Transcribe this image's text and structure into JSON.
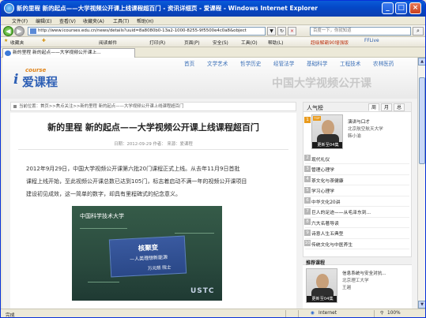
{
  "window": {
    "title": "新的里程 新的起点——大学视频公开课上线课程超百门 - 资讯详细页 - 爱课程 - Windows Internet Explorer",
    "minimize": "_",
    "maximize": "□",
    "close": "×"
  },
  "menubar": {
    "items": [
      "文件(F)",
      "编辑(E)",
      "查看(V)",
      "收藏夹(A)",
      "工具(T)",
      "帮助(H)"
    ]
  },
  "addressbar": {
    "url": "http://www.icourses.edu.cn/news/details?uuid=8a8080b0-13a2-1000-8255-9f5500e4c0a8&object",
    "search_placeholder": "百度一下，你就知道",
    "refresh": "↻",
    "stop": "×",
    "go": "▼",
    "search_btn": "⌕",
    "back": "◀",
    "forward": "▶"
  },
  "toolbar": {
    "favorites": "收藏夹",
    "read_mode": "阅读邮件",
    "print": "打印(R)",
    "page": "页面(P)",
    "safety": "安全(S)",
    "tools": "工具(O)",
    "help": "帮助(L)",
    "ext1": "超级解霸90增强版",
    "ext2": "FFLive",
    "new_tab": "MINI"
  },
  "tab": {
    "label": "新的里程 新的起点——大学视频公开课上..."
  },
  "site": {
    "logo_course": "course",
    "logo_i": "i",
    "logo_text": "爱课程",
    "nav": [
      "首页",
      "文学艺术",
      "哲学历史",
      "经管法学",
      "基础科学",
      "工程技术",
      "农林医药"
    ],
    "banner_title": "中国大学视频公开课"
  },
  "breadcrumb": "当前位置：首页>>焦点关注>>新的里程 新的起点——大学视频公开课上线课程超百门",
  "article": {
    "title": "新的里程 新的起点——大学视频公开课上线课程超百门",
    "meta": "日期：2012-09-29      作者：      来源：爱课程",
    "paragraphs": [
      "2012年9月29日，中国大学视频公开课第六批20门课程正式上线。从去年11月9日首批",
      "课程上线开始，至此视频公开课总数已达到105门，标志着启动不满一年的视频公开课项目",
      "建设初见成效，这一简单的数字，却具有里程碑式的纪念意义。"
    ]
  },
  "video": {
    "university": "中国科学技术大学",
    "heading": "核聚变",
    "subheading": "—人类理想新能源",
    "author": "万元熙  院士",
    "brand": "USTC"
  },
  "sidebar": {
    "title": "人气榜",
    "tabs": [
      "周",
      "月",
      "总"
    ],
    "featured": {
      "rank": "1",
      "course": "演讲与口才",
      "school": "北京航空航天大学",
      "teacher": "韩小渝",
      "caption": "更新至04集",
      "top": "TOP"
    },
    "ranks": [
      {
        "n": "2",
        "title": "现代礼仪"
      },
      {
        "n": "3",
        "title": "管理心理学"
      },
      {
        "n": "4",
        "title": "茶文化与茶健康"
      },
      {
        "n": "5",
        "title": "学习心理学"
      },
      {
        "n": "6",
        "title": "中华文化20讲"
      },
      {
        "n": "7",
        "title": "巨人的足迹——从毛泽东到..."
      },
      {
        "n": "8",
        "title": "六大名著导读"
      },
      {
        "n": "9",
        "title": "诗意人生五典型"
      },
      {
        "n": "10",
        "title": "传统文化与中医养生"
      }
    ]
  },
  "recommend": {
    "title": "推荐课程",
    "course": "信息系统与安全对抗...",
    "school": "北京理工大学",
    "teacher": "王越",
    "caption": "更新至04集"
  },
  "statusbar": {
    "text": "完成",
    "zone": "Internet",
    "zoom": "100%"
  }
}
